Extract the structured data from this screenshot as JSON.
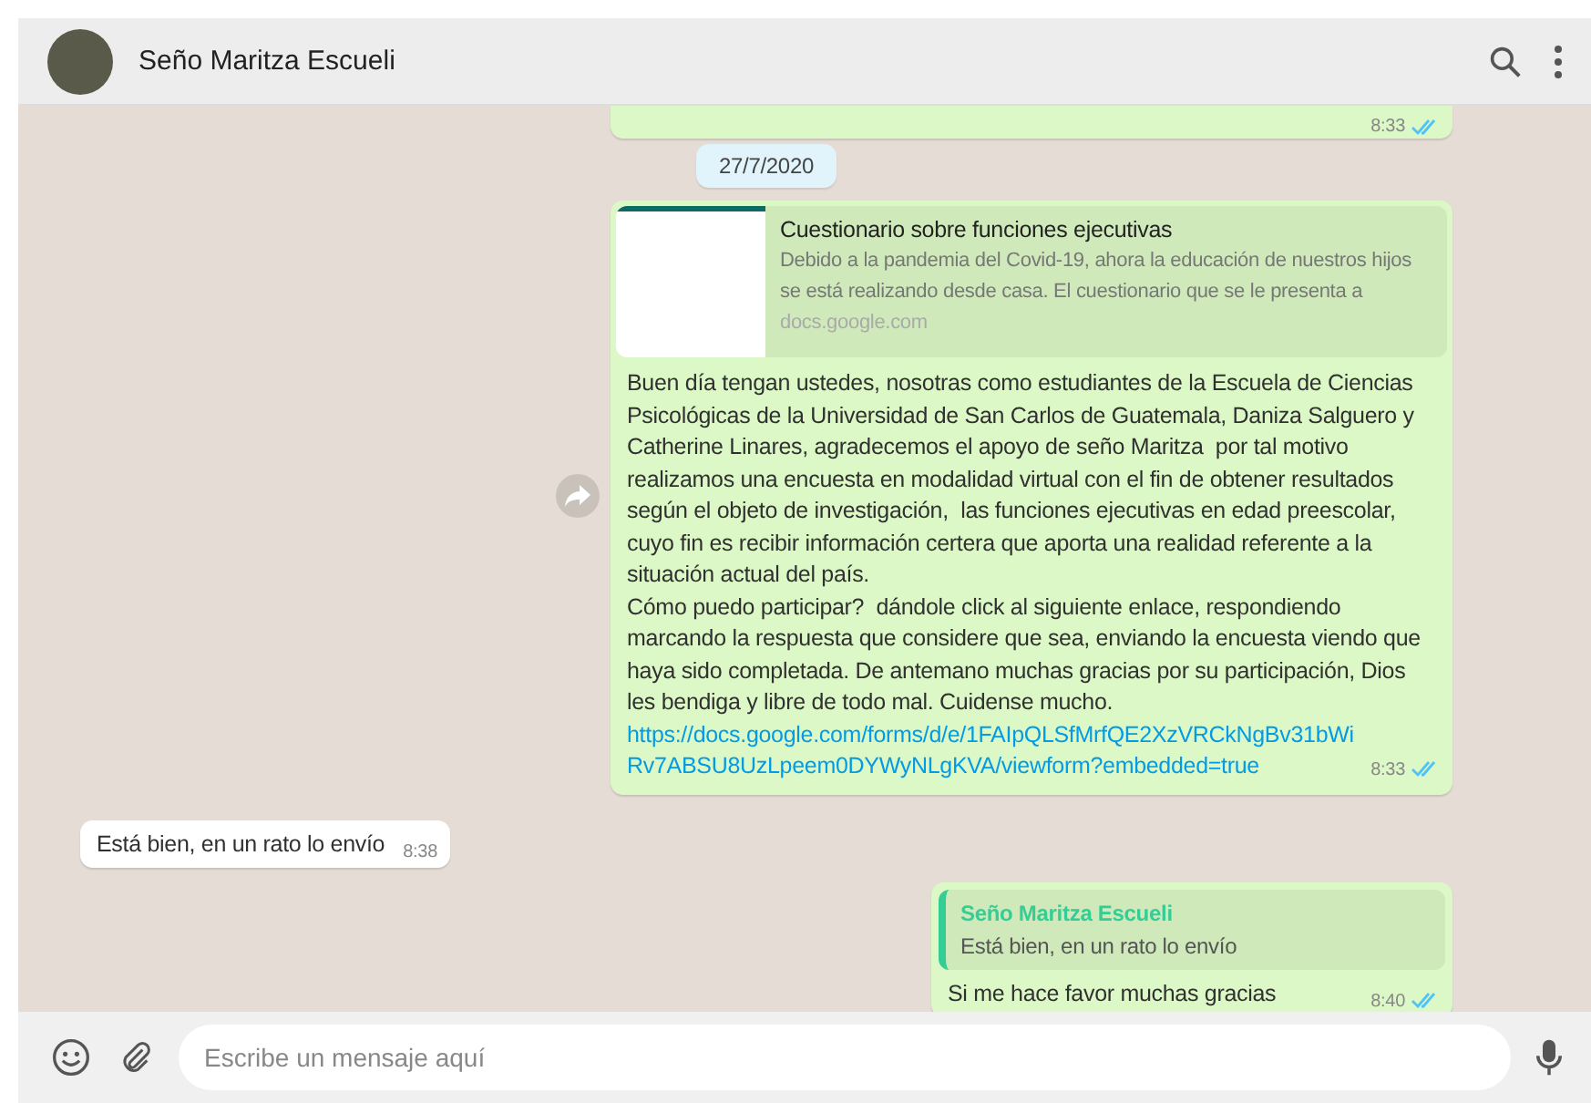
{
  "header": {
    "contact_name": "Seño Maritza Escueli"
  },
  "messages": [
    {
      "kind": "partial",
      "outgoing": true,
      "time": "8:33",
      "read": true
    },
    {
      "kind": "date",
      "text": "27/7/2020"
    },
    {
      "kind": "link",
      "outgoing": true,
      "preview": {
        "title": "Cuestionario sobre funciones ejecutivas",
        "description": "Debido a la pandemia del Covid-19, ahora la educación de nuestros hijos se está realizando desde casa. El cuestionario que se le presenta a",
        "domain": "docs.google.com"
      },
      "text": "Buen día tengan ustedes, nosotras como estudiantes de la Escuela de Ciencias Psicológicas de la Universidad de San Carlos de Guatemala, Daniza Salguero y Catherine Linares, agradecemos el apoyo de seño Maritza  por tal motivo realizamos una encuesta en modalidad virtual con el fin de obtener resultados según el objeto de investigación,  las funciones ejecutivas en edad preescolar, cuyo fin es recibir información certera que aporta una realidad referente a la situación actual del país.\nCómo puedo participar?  dándole click al siguiente enlace, respondiendo marcando la respuesta que considere que sea, enviando la encuesta viendo que haya sido completada. De antemano muchas gracias por su participación, Dios les bendiga y libre de todo mal. Cuidense mucho.",
      "link": "https://docs.google.com/forms/d/e/1FAIpQLSfMrfQE2XzVRCkNgBv31bWiRv7ABSU8UzLpeem0DYWyNLgKVA/viewform?embedded=true",
      "time": "8:33",
      "read": true
    },
    {
      "kind": "text",
      "outgoing": false,
      "text": "Está bien, en un rato lo envío",
      "time": "8:38"
    },
    {
      "kind": "reply",
      "outgoing": true,
      "quote": {
        "author": "Seño Maritza Escueli",
        "text": "Está bien, en un rato lo envío"
      },
      "text": "Si me hace favor muchas gracias",
      "time": "8:40",
      "read": true
    }
  ],
  "composer": {
    "placeholder": "Escribe un mensaje aquí"
  }
}
